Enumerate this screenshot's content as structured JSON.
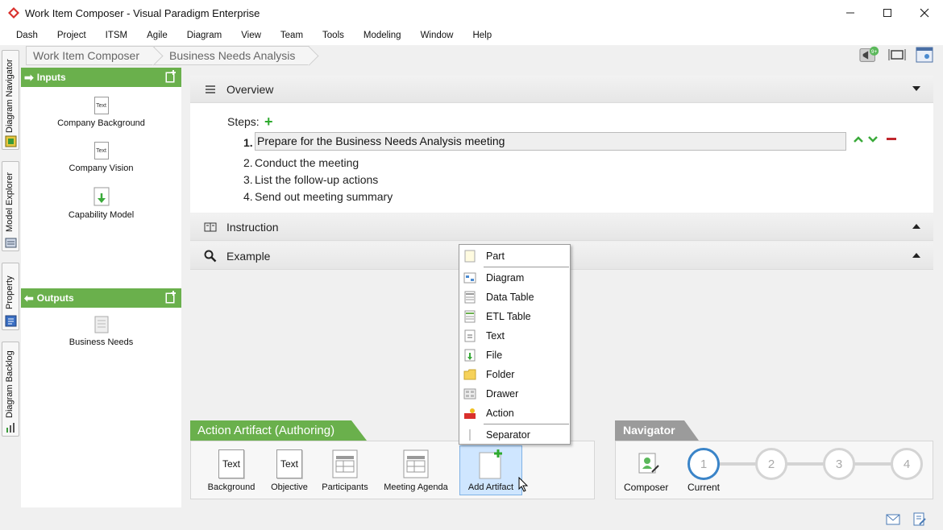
{
  "window": {
    "title": "Work Item Composer - Visual Paradigm Enterprise",
    "controls": [
      "minimize-icon",
      "maximize-icon",
      "close-icon"
    ]
  },
  "menubar": [
    "Dash",
    "Project",
    "ITSM",
    "Agile",
    "Diagram",
    "View",
    "Team",
    "Tools",
    "Modeling",
    "Window",
    "Help"
  ],
  "vertical_tabs": [
    "Diagram Navigator",
    "Model Explorer",
    "Property",
    "Diagram Backlog"
  ],
  "breadcrumb": [
    "Work Item Composer",
    "Business Needs Analysis"
  ],
  "top_tools": {
    "badge": "9+"
  },
  "inputs": {
    "title": "Inputs",
    "items": [
      {
        "label": "Company Background",
        "icon_text": "Text"
      },
      {
        "label": "Company Vision",
        "icon_text": "Text"
      },
      {
        "label": "Capability Model",
        "icon_text": ""
      }
    ]
  },
  "outputs": {
    "title": "Outputs",
    "items": [
      {
        "label": "Business Needs",
        "icon_text": ""
      }
    ]
  },
  "overview": {
    "title": "Overview",
    "steps_label": "Steps:",
    "steps": [
      {
        "num": "1.",
        "text": "Prepare for the Business Needs Analysis meeting"
      },
      {
        "num": "2.",
        "text": "Conduct the meeting"
      },
      {
        "num": "3.",
        "text": "List the follow-up actions"
      },
      {
        "num": "4.",
        "text": "Send out meeting summary"
      }
    ]
  },
  "instruction": {
    "title": "Instruction"
  },
  "example": {
    "title": "Example"
  },
  "popup_menu": {
    "items": [
      "Part",
      "Diagram",
      "Data Table",
      "ETL Table",
      "Text",
      "File",
      "Folder",
      "Drawer",
      "Action",
      "Separator"
    ]
  },
  "action_artifact": {
    "title": "Action Artifact (Authoring)",
    "items": [
      {
        "label": "Background",
        "icon_text": "Text"
      },
      {
        "label": "Objective",
        "icon_text": "Text"
      },
      {
        "label": "Participants",
        "icon_text": ""
      },
      {
        "label": "Meeting Agenda",
        "icon_text": ""
      }
    ],
    "add_label": "Add Artifact"
  },
  "navigator": {
    "title": "Navigator",
    "composer_label": "Composer",
    "current_label": "Current",
    "steps": [
      "1",
      "2",
      "3",
      "4"
    ],
    "current_step": 1
  },
  "colors": {
    "accent_green": "#6ab04c",
    "navigator_gray": "#9b9b9b",
    "current_blue": "#3a84c8"
  }
}
